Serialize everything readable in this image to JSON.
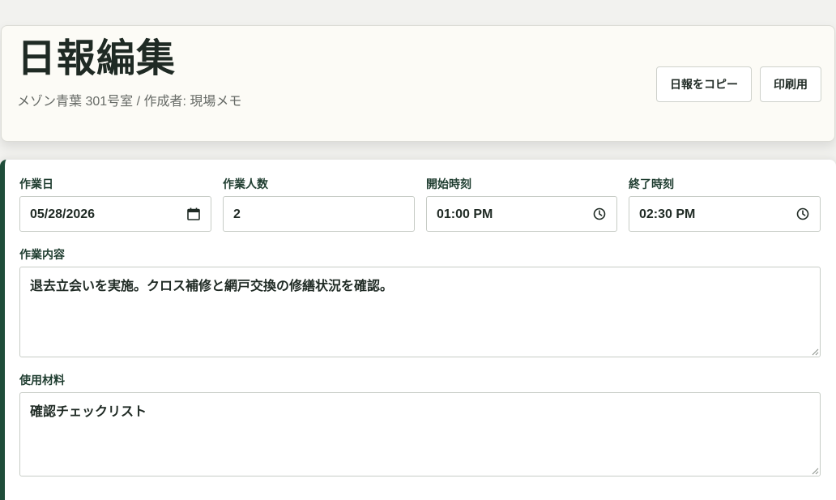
{
  "header": {
    "title": "日報編集",
    "subtitle": "メゾン青葉 301号室 / 作成者: 現場メモ",
    "copy_button_label": "日報をコピー",
    "print_button_label": "印刷用"
  },
  "form": {
    "work_date": {
      "label": "作業日",
      "value": "05/28/2026",
      "icon": "calendar-icon"
    },
    "worker_count": {
      "label": "作業人数",
      "value": "2"
    },
    "start_time": {
      "label": "開始時刻",
      "value": "01:00 PM",
      "icon": "clock-icon"
    },
    "end_time": {
      "label": "終了時刻",
      "value": "02:30 PM",
      "icon": "clock-icon"
    },
    "work_content": {
      "label": "作業内容",
      "value": "退去立会いを実施。クロス補修と網戸交換の修繕状況を確認。"
    },
    "materials": {
      "label": "使用材料",
      "value": "確認チェックリスト"
    }
  },
  "colors": {
    "accent": "#1f4d3a",
    "header_background": "#fcfbf6",
    "page_background": "#f2f2ef",
    "label_text": "#1f3d30"
  }
}
